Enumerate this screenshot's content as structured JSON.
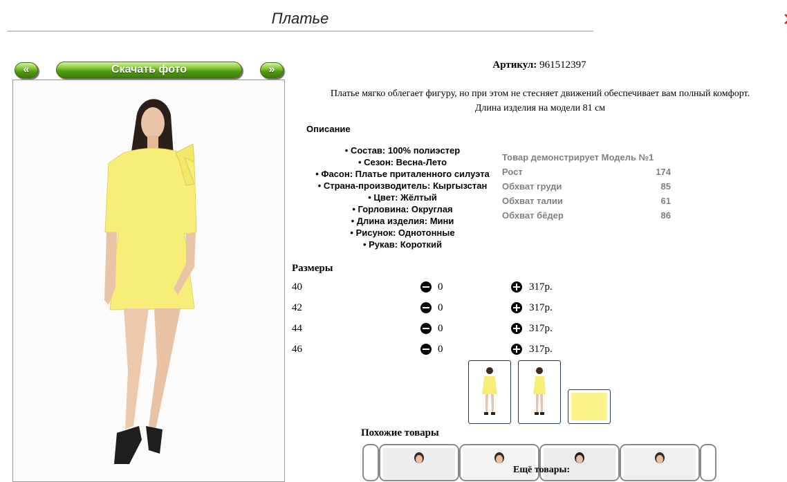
{
  "page": {
    "title": "Платье"
  },
  "toolbar": {
    "prev_label": "«",
    "download_label": "Скачать фото",
    "next_label": "»"
  },
  "product": {
    "article_label": "Артикул:",
    "article_value": "961512397",
    "blurb_line1": "Платье мягко облегает фигуру, но при этом не стесняет движений обеспечивает вам полный комфорт.",
    "blurb_line2": "Длина изделия на модели 81 см"
  },
  "description": {
    "heading": "Описание",
    "items": [
      "Состав: 100% полиэстер",
      "Сезон: Весна-Лето",
      "Фасон: Платье приталенного силуэта",
      "Страна-производитель: Кыргызстан",
      "Цвет: Жёлтый",
      "Горловина: Округлая",
      "Длина изделия: Мини",
      "Рисунок: Однотонные",
      "Рукав: Короткий"
    ]
  },
  "model": {
    "heading": "Товар демонстрирует Модель №1",
    "rows": [
      {
        "label": "Рост",
        "value": "174"
      },
      {
        "label": "Обхват груди",
        "value": "85"
      },
      {
        "label": "Обхват талии",
        "value": "61"
      },
      {
        "label": "Обхват бёдер",
        "value": "86"
      }
    ]
  },
  "sizes": {
    "heading": "Размеры",
    "rows": [
      {
        "size": "40",
        "qty": "0",
        "price": "317р."
      },
      {
        "size": "42",
        "qty": "0",
        "price": "317р."
      },
      {
        "size": "44",
        "qty": "0",
        "price": "317р."
      },
      {
        "size": "46",
        "qty": "0",
        "price": "317р."
      }
    ]
  },
  "similar": {
    "heading": "Похожие товары"
  },
  "more": {
    "heading": "Ещё товары:"
  },
  "colors": {
    "accent_green": "#4f9a12",
    "dress_yellow": "#f7ee7a",
    "thumb_border": "#1f3558",
    "close_red": "#d4282e"
  },
  "icons": [
    "close-icon",
    "minus-icon",
    "plus-icon"
  ]
}
